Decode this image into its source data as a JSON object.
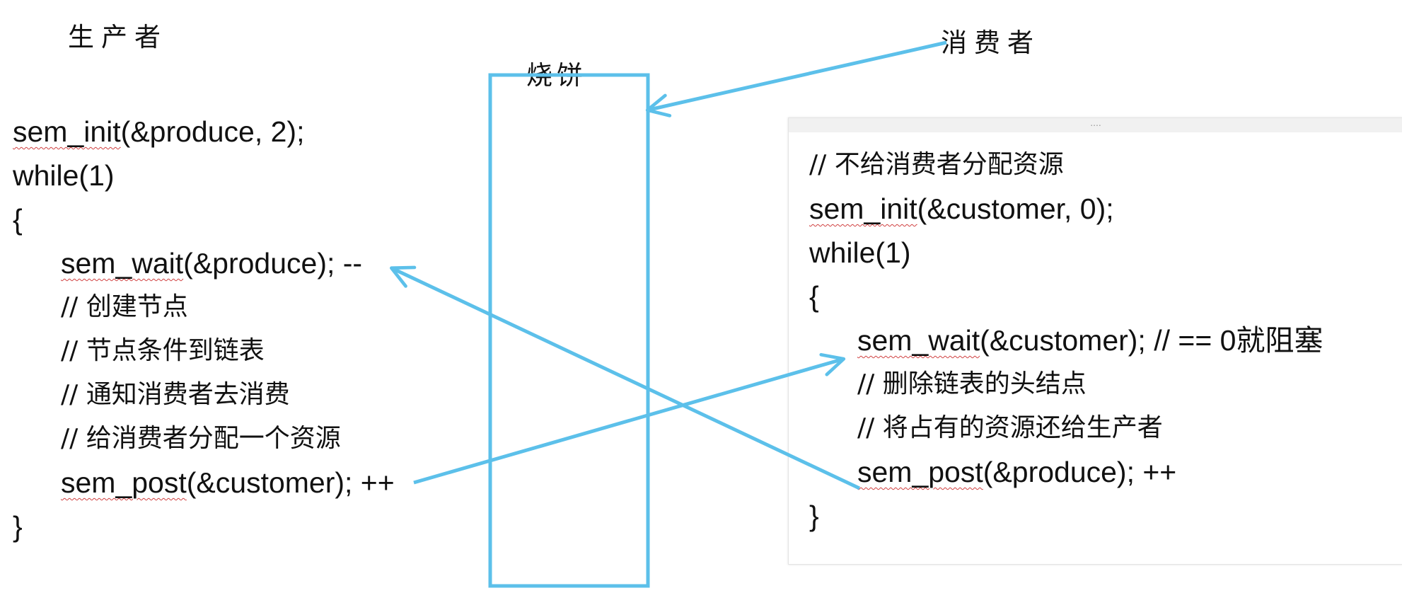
{
  "labels": {
    "producer": "生产者",
    "consumer": "消费者",
    "buffer": "烧饼"
  },
  "producer": {
    "lines": {
      "init_fn": "sem_init",
      "init_rest": "(&produce, 2);",
      "while": "while(1)",
      "open_brace": "{",
      "wait_fn": "sem_wait",
      "wait_rest": "(&produce); --",
      "comment1": "// 创建节点",
      "comment2": "// 节点条件到链表",
      "comment3": "// 通知消费者去消费",
      "comment4": "// 给消费者分配一个资源",
      "post_fn": "sem_post",
      "post_rest": "(&customer); ++",
      "close_brace": "}"
    }
  },
  "consumer": {
    "panel_grip": "....",
    "lines": {
      "comment0": "// 不给消费者分配资源",
      "init_fn": "sem_init",
      "init_rest": "(&customer, 0);",
      "while": "while(1)",
      "open_brace": "{",
      "wait_fn": "sem_wait",
      "wait_rest": "(&customer); // == 0就阻塞",
      "comment1": "// 删除链表的头结点",
      "comment2": "// 将占有的资源还给生产者",
      "post_fn": "sem_post",
      "post_rest": "(&produce);  ++",
      "close_brace": "}"
    }
  },
  "colors": {
    "arrow": "#5cc0ea",
    "text": "#111111",
    "squiggle": "#d04040"
  }
}
